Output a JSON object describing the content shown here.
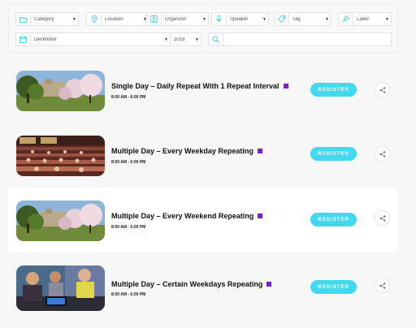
{
  "filters": {
    "category": "Category",
    "location": "Location",
    "organizer": "Organizer",
    "speaker": "Speaker",
    "tag": "Tag",
    "label": "Label",
    "month": "December",
    "year": "2019",
    "search_placeholder": ""
  },
  "events": [
    {
      "title": "Single Day – Daily Repeat With 1 Repeat Interval",
      "time": "8:00 AM - 6:00 PM",
      "register": "REGISTER",
      "label_color": "#7a1fd0"
    },
    {
      "title": "Multiple Day – Every Weekday Repeating",
      "time": "8:00 AM - 6:00 PM",
      "register": "REGISTER",
      "label_color": "#7a1fd0"
    },
    {
      "title": "Multiple Day – Every Weekend Repeating",
      "time": "8:00 AM - 6:00 PM",
      "register": "REGISTER",
      "label_color": "#7a1fd0"
    },
    {
      "title": "Multiple Day – Certain Weekdays Repeating",
      "time": "8:00 AM - 6:00 PM",
      "register": "REGISTER",
      "label_color": "#7a1fd0"
    }
  ],
  "colors": {
    "accent": "#40d9f1",
    "label_square": "#7a1fd0"
  }
}
